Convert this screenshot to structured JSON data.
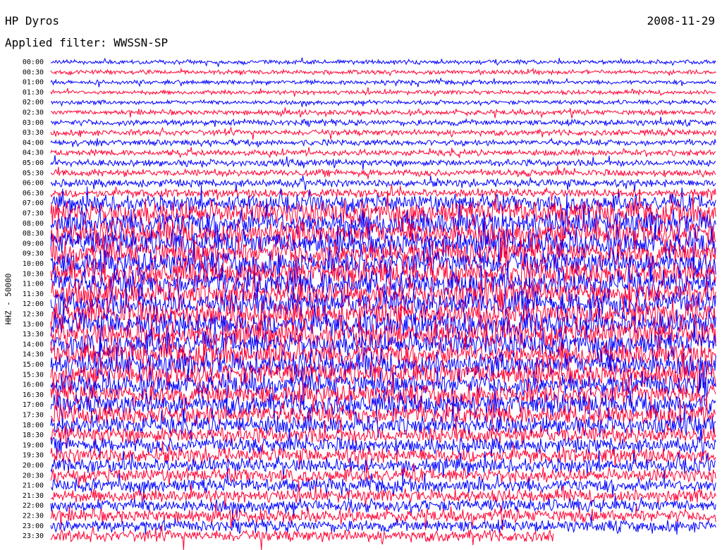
{
  "header": {
    "station": "HP Dyros",
    "date": "2008-11-29",
    "filter_label": "Applied filter: WWSSN-SP"
  },
  "chart_data": {
    "type": "line",
    "title": "HP Dyros",
    "subtitle": "Applied filter: WWSSN-SP",
    "ylabel": "HHZ - 50000",
    "xlabel": "",
    "grid": false,
    "colors": [
      "#0000ff",
      "#ff0033"
    ],
    "rows": [
      {
        "label": "00:00",
        "amplitude": 0.25
      },
      {
        "label": "00:30",
        "amplitude": 0.25
      },
      {
        "label": "01:00",
        "amplitude": 0.25
      },
      {
        "label": "01:30",
        "amplitude": 0.25
      },
      {
        "label": "02:00",
        "amplitude": 0.25
      },
      {
        "label": "02:30",
        "amplitude": 0.3
      },
      {
        "label": "03:00",
        "amplitude": 0.35
      },
      {
        "label": "03:30",
        "amplitude": 0.35
      },
      {
        "label": "04:00",
        "amplitude": 0.35
      },
      {
        "label": "04:30",
        "amplitude": 0.35
      },
      {
        "label": "05:00",
        "amplitude": 0.4
      },
      {
        "label": "05:30",
        "amplitude": 0.4
      },
      {
        "label": "06:00",
        "amplitude": 0.45
      },
      {
        "label": "06:30",
        "amplitude": 0.5
      },
      {
        "label": "07:00",
        "amplitude": 1.0
      },
      {
        "label": "07:30",
        "amplitude": 1.4
      },
      {
        "label": "08:00",
        "amplitude": 1.5
      },
      {
        "label": "08:30",
        "amplitude": 1.5
      },
      {
        "label": "09:00",
        "amplitude": 1.5
      },
      {
        "label": "09:30",
        "amplitude": 1.5
      },
      {
        "label": "10:00",
        "amplitude": 1.5
      },
      {
        "label": "10:30",
        "amplitude": 1.5
      },
      {
        "label": "11:00",
        "amplitude": 1.5
      },
      {
        "label": "11:30",
        "amplitude": 1.5
      },
      {
        "label": "12:00",
        "amplitude": 1.5
      },
      {
        "label": "12:30",
        "amplitude": 1.5
      },
      {
        "label": "13:00",
        "amplitude": 1.5
      },
      {
        "label": "13:30",
        "amplitude": 1.5
      },
      {
        "label": "14:00",
        "amplitude": 1.4
      },
      {
        "label": "14:30",
        "amplitude": 1.4
      },
      {
        "label": "15:00",
        "amplitude": 1.4
      },
      {
        "label": "15:30",
        "amplitude": 1.4
      },
      {
        "label": "16:00",
        "amplitude": 1.3
      },
      {
        "label": "16:30",
        "amplitude": 1.3
      },
      {
        "label": "17:00",
        "amplitude": 1.3
      },
      {
        "label": "17:30",
        "amplitude": 1.2
      },
      {
        "label": "18:00",
        "amplitude": 1.1
      },
      {
        "label": "18:30",
        "amplitude": 1.0
      },
      {
        "label": "19:00",
        "amplitude": 0.9
      },
      {
        "label": "19:30",
        "amplitude": 0.9
      },
      {
        "label": "20:00",
        "amplitude": 0.85
      },
      {
        "label": "20:30",
        "amplitude": 0.8
      },
      {
        "label": "21:00",
        "amplitude": 0.8
      },
      {
        "label": "21:30",
        "amplitude": 0.75
      },
      {
        "label": "22:00",
        "amplitude": 0.75
      },
      {
        "label": "22:30",
        "amplitude": 0.75
      },
      {
        "label": "23:00",
        "amplitude": 0.7
      },
      {
        "label": "23:30",
        "amplitude": 0.7
      }
    ]
  }
}
